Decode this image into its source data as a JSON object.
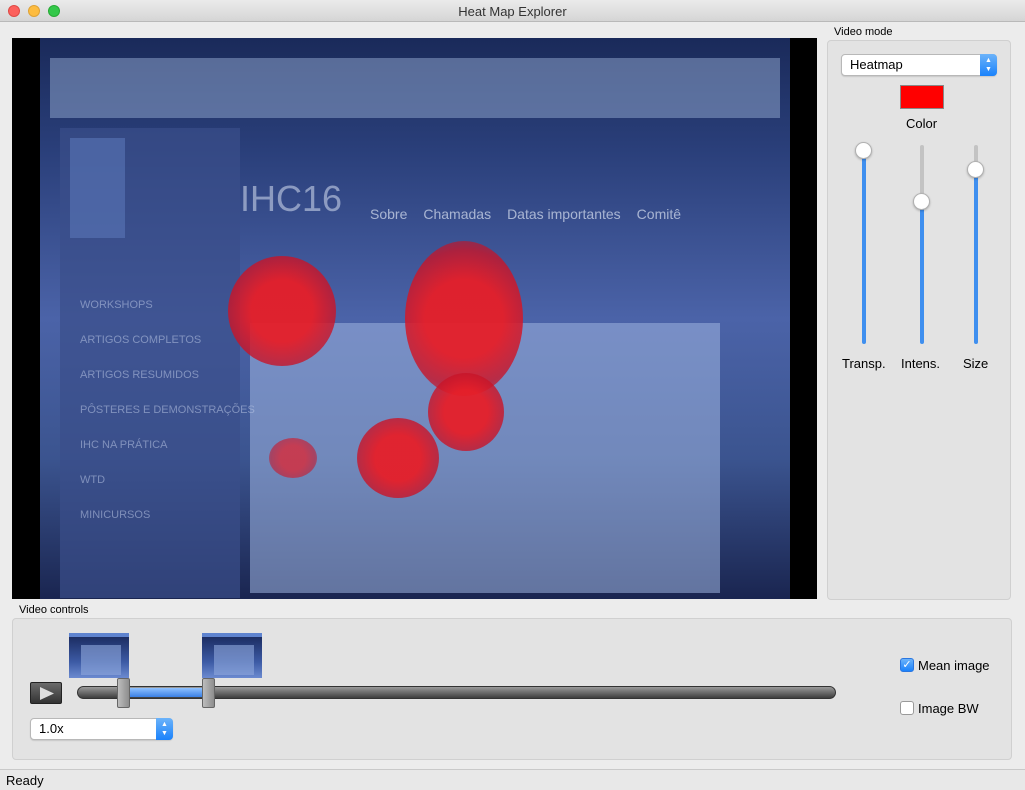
{
  "window": {
    "title": "Heat Map Explorer"
  },
  "video_mode": {
    "group_label": "Video mode",
    "mode_value": "Heatmap",
    "color_label": "Color",
    "color_value": "#ff0000",
    "sliders": [
      {
        "label": "Transp.",
        "value": 1.0
      },
      {
        "label": "Intens.",
        "value": 0.72
      },
      {
        "label": "Size",
        "value": 0.87
      }
    ]
  },
  "video_controls": {
    "group_label": "Video controls",
    "speed_value": "1.0x",
    "mean_image": {
      "label": "Mean image",
      "checked": true
    },
    "image_bw": {
      "label": "Image BW",
      "checked": false
    }
  },
  "status": {
    "text": "Ready"
  },
  "colors": {
    "accent": "#1a82fb",
    "heat": "#e31e28"
  },
  "icons": {
    "play": "play-icon",
    "stepper": "chevron-updown-icon",
    "check": "check-icon"
  }
}
